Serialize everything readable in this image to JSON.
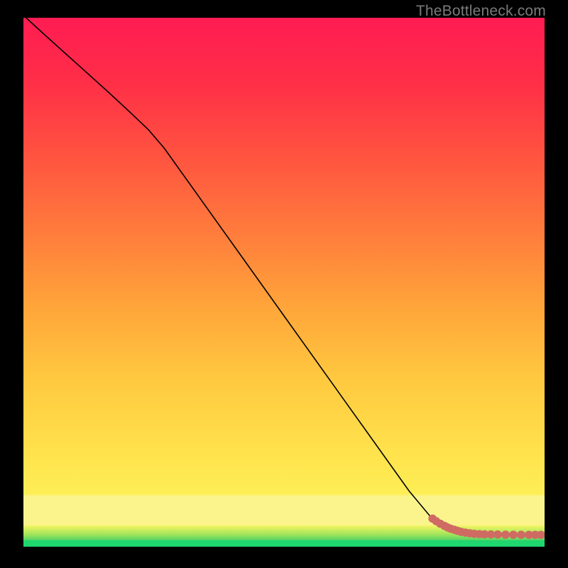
{
  "watermark": "TheBottleneck.com",
  "chart_data": {
    "type": "line",
    "title": "",
    "xlabel": "",
    "ylabel": "",
    "x_range": [
      0,
      100
    ],
    "y_range": [
      0,
      100
    ],
    "series": [
      {
        "name": "curve",
        "color": "#000000",
        "x": [
          0.5,
          4,
          8,
          12,
          16,
          20,
          24,
          27,
          30,
          34,
          38,
          42,
          46,
          50,
          54,
          58,
          62,
          66,
          70,
          74,
          78,
          81,
          84,
          86.5,
          88.5,
          90.5,
          92,
          94,
          96,
          98,
          99.5
        ],
        "y": [
          100,
          96.8,
          93.2,
          89.6,
          86,
          82.3,
          78.5,
          75,
          70.8,
          65.2,
          59.6,
          54,
          48.4,
          42.8,
          37.2,
          31.6,
          26,
          20.4,
          14.8,
          9.2,
          4.4,
          2.0,
          1.1,
          0.9,
          0.85,
          0.82,
          0.8,
          0.78,
          0.77,
          0.77,
          0.77
        ]
      }
    ],
    "points": {
      "name": "markers",
      "color": "#cf6b63",
      "radius_frac": 0.008,
      "x": [
        78.5,
        79.2,
        80.0,
        80.8,
        81.4,
        82.0,
        82.7,
        83.3,
        84.0,
        84.8,
        85.6,
        86.5,
        87.5,
        88.5,
        89.7,
        91.0,
        92.5,
        94.0,
        95.5,
        97.0,
        98.2,
        99.3
      ],
      "y": [
        3.9,
        3.4,
        2.9,
        2.5,
        2.2,
        1.95,
        1.75,
        1.55,
        1.35,
        1.2,
        1.08,
        0.98,
        0.92,
        0.88,
        0.86,
        0.84,
        0.82,
        0.8,
        0.79,
        0.78,
        0.78,
        0.78
      ]
    },
    "background": {
      "type": "vertical-gradient",
      "stops": [
        {
          "pos": 0.0,
          "color": "#1fd66f"
        },
        {
          "pos": 0.012,
          "color": "#1fd66f"
        },
        {
          "pos": 0.04,
          "color": "#fbf48d"
        },
        {
          "pos": 0.095,
          "color": "#fbf48d"
        },
        {
          "pos": 0.18,
          "color": "#ffe24c"
        },
        {
          "pos": 0.32,
          "color": "#ffc83f"
        },
        {
          "pos": 0.46,
          "color": "#ffa33a"
        },
        {
          "pos": 0.6,
          "color": "#ff7a3c"
        },
        {
          "pos": 0.74,
          "color": "#ff5340"
        },
        {
          "pos": 0.88,
          "color": "#ff2e47"
        },
        {
          "pos": 1.0,
          "color": "#ff1c53"
        }
      ]
    }
  }
}
